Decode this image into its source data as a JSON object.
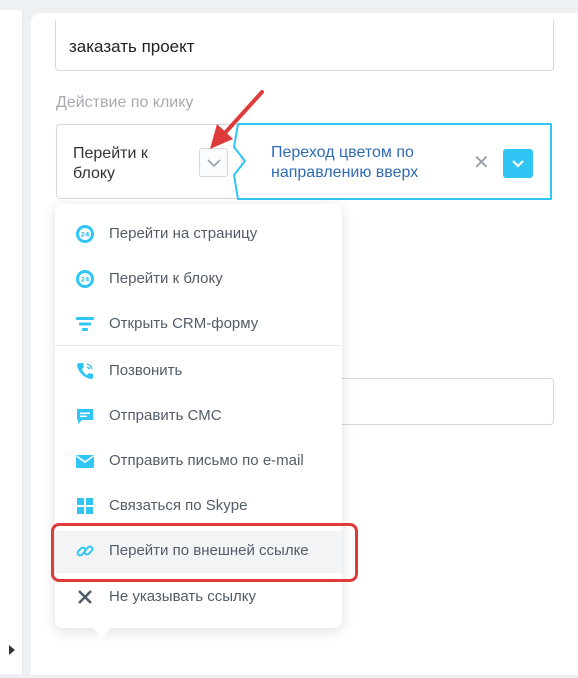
{
  "form": {
    "title_value": "заказать проект",
    "click_action_label": "Действие по клику",
    "click_action_value": "Перейти к блоку",
    "effect_value": "Переход цветом по направлению вверх",
    "effect_clear": "✕"
  },
  "dropdown": {
    "items": [
      {
        "label": "Перейти на страницу",
        "icon": "bitrix24-cloud-icon"
      },
      {
        "label": "Перейти к блоку",
        "icon": "bitrix24-cloud-icon"
      },
      {
        "label": "Открыть CRM-форму",
        "icon": "funnel-icon"
      },
      {
        "label": "Позвонить",
        "icon": "phone-icon"
      },
      {
        "label": "Отправить СМС",
        "icon": "sms-icon"
      },
      {
        "label": "Отправить письмо по e-mail",
        "icon": "envelope-icon"
      },
      {
        "label": "Связаться по Skype",
        "icon": "windows-grid-icon"
      },
      {
        "label": "Перейти по внешней ссылке",
        "icon": "link-icon"
      },
      {
        "label": "Не указывать ссылку",
        "icon": "close-icon"
      }
    ],
    "highlighted_item": "Перейти по внешней ссылке"
  },
  "colors": {
    "accent": "#2fc6f6",
    "effect_text": "#2f6bb5",
    "annotation_red": "#e03b3b"
  }
}
